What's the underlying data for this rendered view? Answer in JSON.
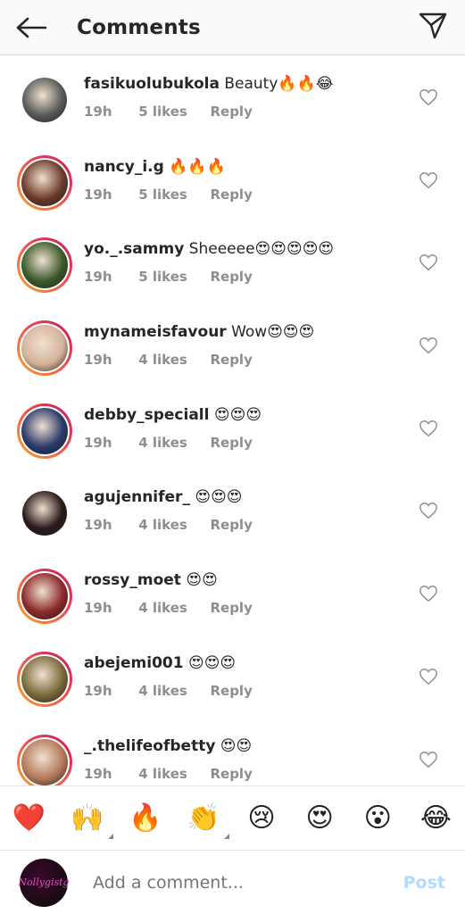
{
  "header": {
    "title": "Comments"
  },
  "comments": [
    {
      "username": "fasikuolubukola",
      "text": " Beauty🔥🔥😂",
      "time": "19h",
      "likes": "5 likes",
      "reply": "Reply",
      "ring": false,
      "avatar_color": "#5a5a5a"
    },
    {
      "username": "nancy_i.g",
      "text": " 🔥🔥🔥",
      "time": "19h",
      "likes": "5 likes",
      "reply": "Reply",
      "ring": true,
      "avatar_color": "#6b3a2a"
    },
    {
      "username": "yo._.sammy",
      "text": " Sheeeee😍😍😍😍😍",
      "time": "19h",
      "likes": "5 likes",
      "reply": "Reply",
      "ring": true,
      "avatar_color": "#3c5a2a"
    },
    {
      "username": "mynameisfavour",
      "text": " Wow😍😍😍",
      "time": "19h",
      "likes": "4 likes",
      "reply": "Reply",
      "ring": true,
      "avatar_color": "#d4b39a"
    },
    {
      "username": "debby_speciall",
      "text": " 😍😍😍",
      "time": "19h",
      "likes": "4 likes",
      "reply": "Reply",
      "ring": true,
      "avatar_color": "#2a3a6b"
    },
    {
      "username": "agujennifer_",
      "text": " 😍😍😍",
      "time": "19h",
      "likes": "4 likes",
      "reply": "Reply",
      "ring": false,
      "avatar_color": "#2a1a1a"
    },
    {
      "username": "rossy_moet",
      "text": " 😍😍",
      "time": "19h",
      "likes": "4 likes",
      "reply": "Reply",
      "ring": true,
      "avatar_color": "#8a2a2a"
    },
    {
      "username": "abejemi001",
      "text": " 😍😍😍",
      "time": "19h",
      "likes": "4 likes",
      "reply": "Reply",
      "ring": true,
      "avatar_color": "#7a6a3a"
    },
    {
      "username": "_.thelifeofbetty",
      "text": " 😍😍",
      "time": "19h",
      "likes": "4 likes",
      "reply": "Reply",
      "ring": true,
      "avatar_color": "#b57a5a"
    }
  ],
  "emoji_bar": [
    "❤️",
    "🙌",
    "🔥",
    "👏",
    "😢",
    "😍",
    "😮",
    "😂"
  ],
  "composer": {
    "placeholder": "Add a comment...",
    "post_label": "Post",
    "avatar_text": "Nollygistg"
  },
  "colors": {
    "ring_start": "#f9a825",
    "ring_end": "#c2185b",
    "post_disabled": "#b3dbff",
    "muted": "#8e8e8e"
  }
}
